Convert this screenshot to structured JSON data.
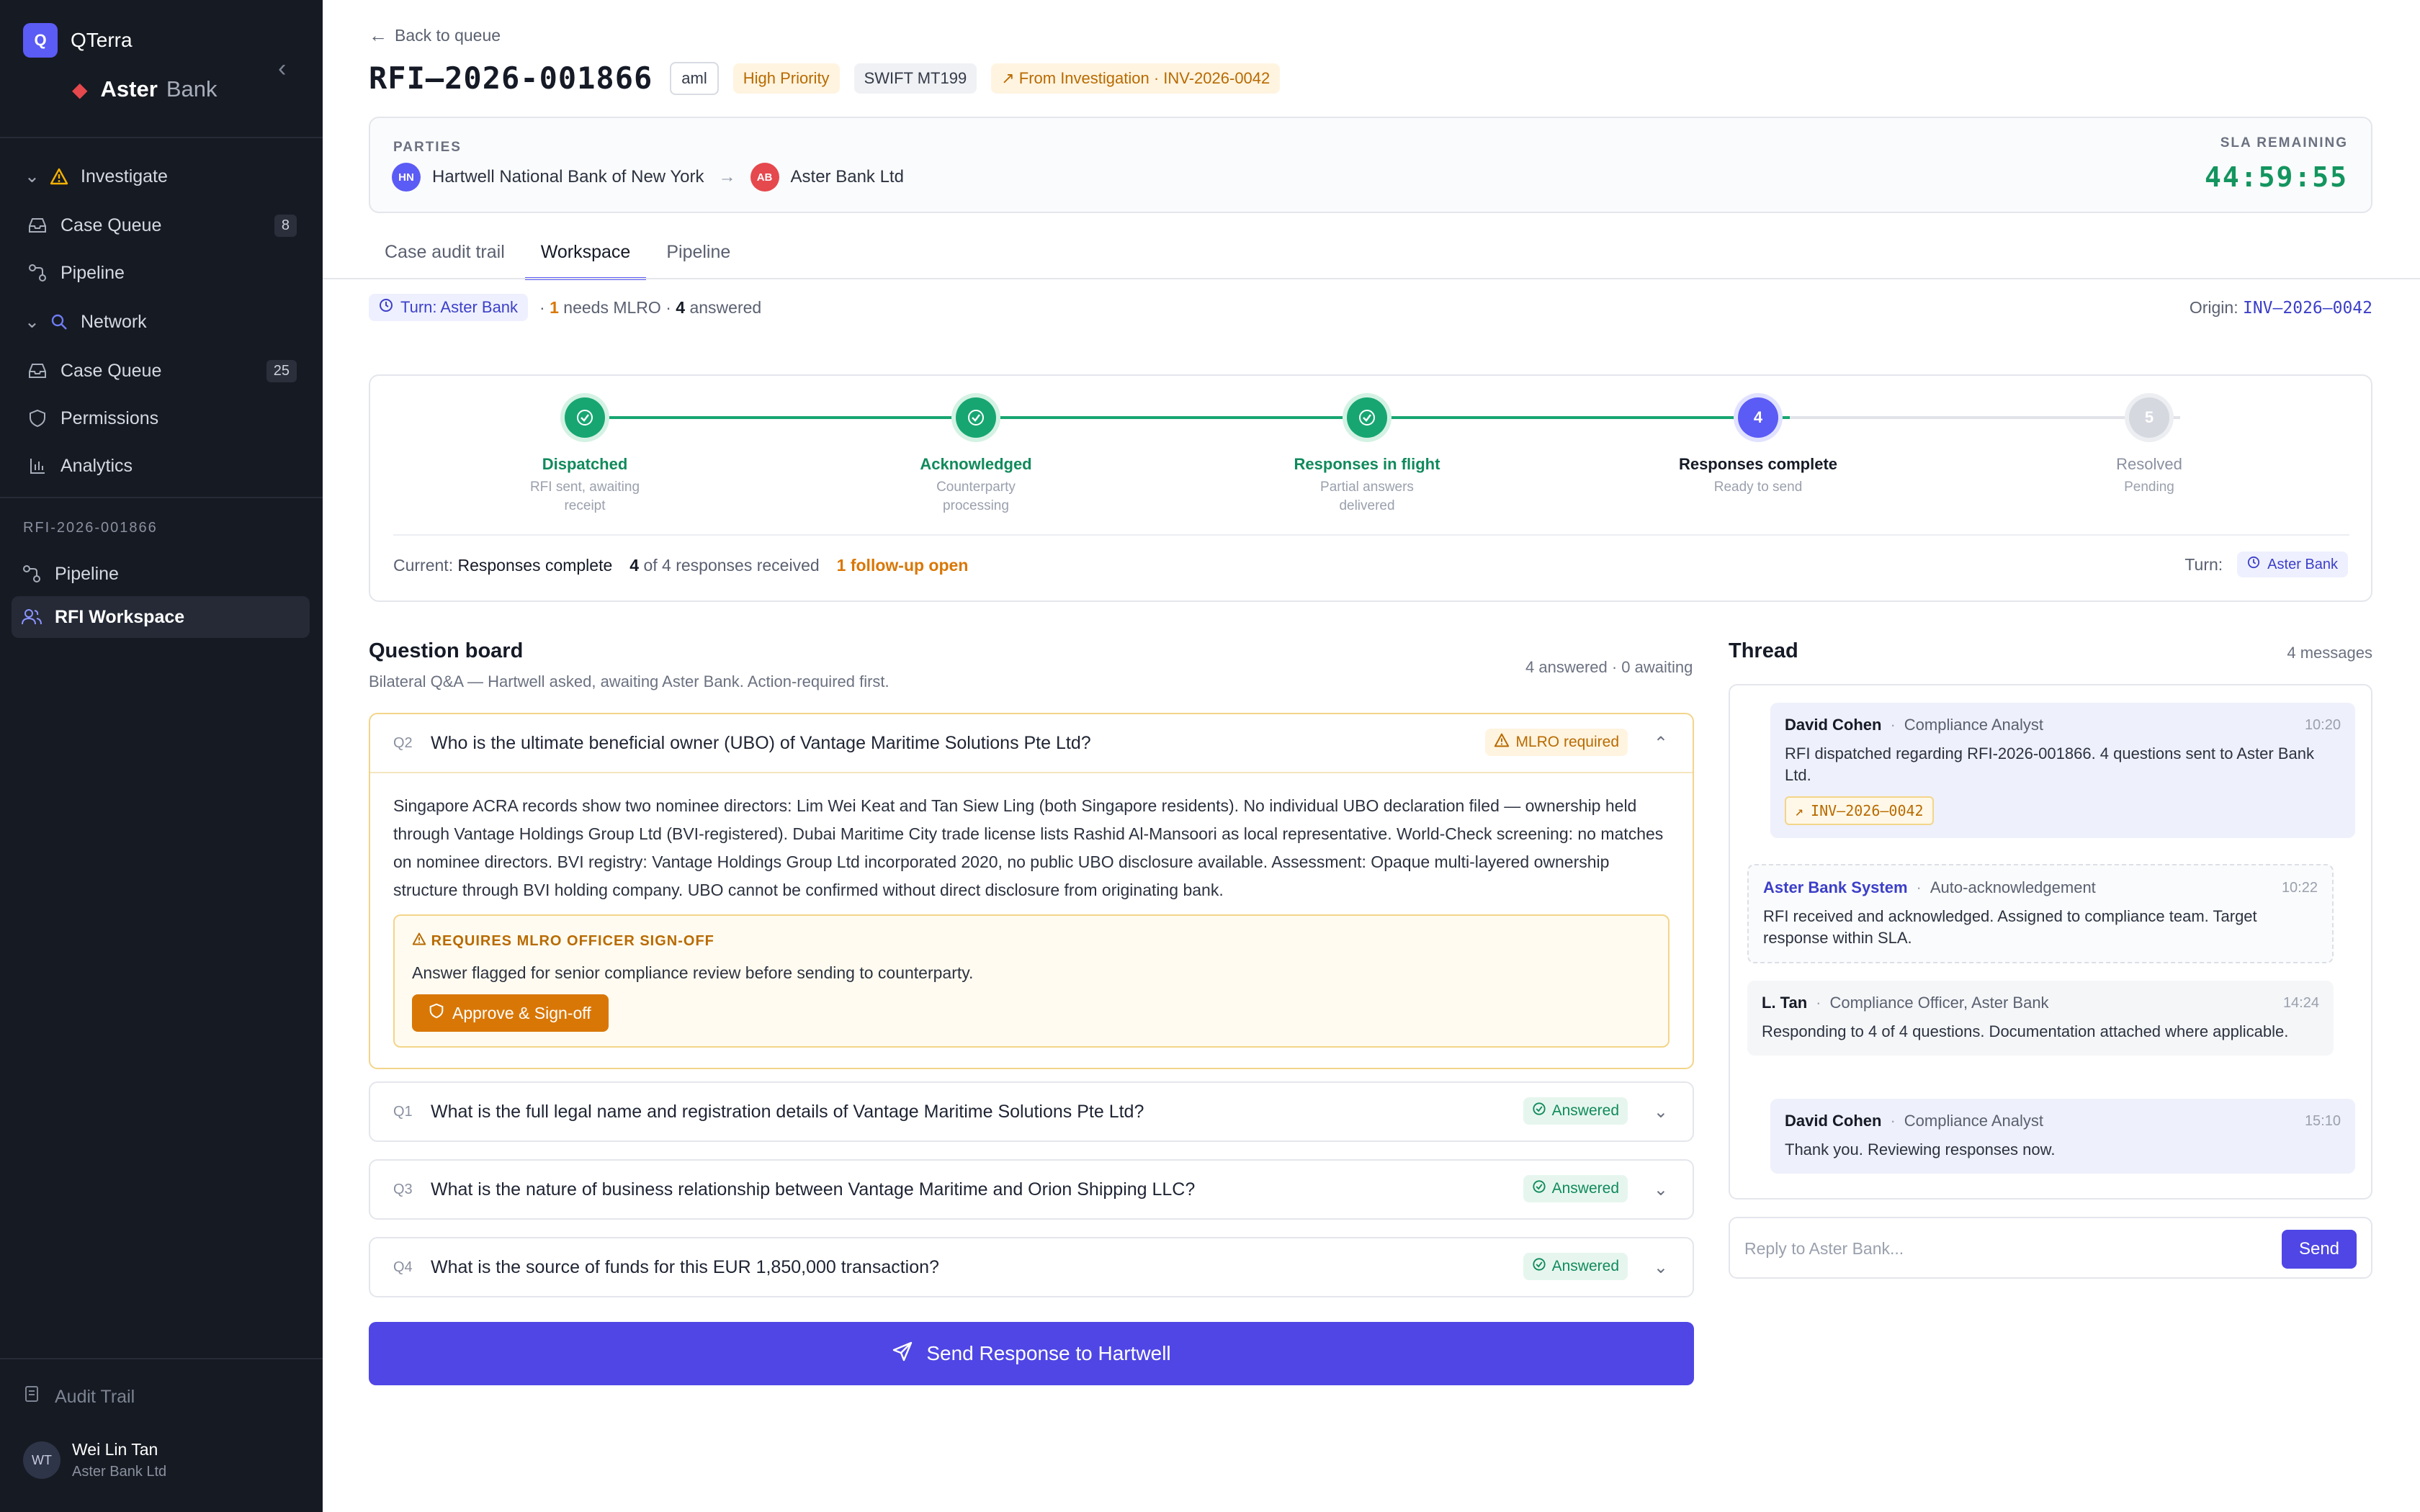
{
  "sidebar": {
    "app_name": "QTerra",
    "logo_letter": "Q",
    "bank_name_bold": "Aster",
    "bank_name_light": "Bank",
    "groups": {
      "investigate": {
        "label": "Investigate",
        "items": [
          {
            "label": "Case Queue",
            "count": "8"
          },
          {
            "label": "Pipeline"
          }
        ]
      },
      "network": {
        "label": "Network",
        "items": [
          {
            "label": "Case Queue",
            "count": "25"
          },
          {
            "label": "Permissions"
          },
          {
            "label": "Analytics"
          }
        ]
      }
    },
    "case_section": "RFI-2026-001866",
    "case_items": [
      {
        "label": "Pipeline"
      },
      {
        "label": "RFI Workspace"
      }
    ],
    "audit_trail": "Audit Trail",
    "user": {
      "initials": "WT",
      "name": "Wei Lin Tan",
      "org": "Aster Bank Ltd"
    }
  },
  "header": {
    "back": "Back to queue",
    "title": "RFI–2026-001866",
    "tags": {
      "aml": "aml",
      "priority": "High Priority",
      "swift": "SWIFT MT199",
      "investigation": "From Investigation · INV-2026-0042"
    }
  },
  "parties": {
    "label": "PARTIES",
    "from": {
      "initials": "HN",
      "name": "Hartwell National Bank of New York"
    },
    "to": {
      "initials": "AB",
      "name": "Aster Bank Ltd"
    },
    "sla_label": "SLA REMAINING",
    "sla_value": "44:59:55"
  },
  "tabs": [
    "Case audit trail",
    "Workspace",
    "Pipeline"
  ],
  "status": {
    "turn": "Turn: Aster Bank",
    "needs_count": "1",
    "needs_label": "needs MLRO",
    "answered_count": "4",
    "answered_label": "answered",
    "origin_label": "Origin:",
    "origin_value": "INV–2026–0042"
  },
  "progress": {
    "steps": [
      {
        "title": "Dispatched",
        "sub": "RFI sent, awaiting receipt",
        "state": "done"
      },
      {
        "title": "Acknowledged",
        "sub": "Counterparty processing",
        "state": "done"
      },
      {
        "title": "Responses in flight",
        "sub": "Partial answers delivered",
        "state": "done"
      },
      {
        "title": "Responses complete",
        "sub": "Ready to send",
        "state": "current",
        "num": "4"
      },
      {
        "title": "Resolved",
        "sub": "Pending",
        "state": "pending",
        "num": "5"
      }
    ],
    "current_label": "Current:",
    "current_value": "Responses complete",
    "received_count": "4",
    "received_label": "of 4 responses received",
    "followup": "1 follow-up open",
    "turn_label": "Turn:",
    "turn_value": "Aster Bank"
  },
  "question_board": {
    "title": "Question board",
    "subtitle": "Bilateral Q&A — Hartwell asked, awaiting Aster Bank. Action-required first.",
    "counts": "4 answered · 0 awaiting",
    "questions": [
      {
        "num": "Q2",
        "text": "Who is the ultimate beneficial owner (UBO) of Vantage Maritime Solutions Pte Ltd?",
        "badge": "MLRO required",
        "answer": "Singapore ACRA records show two nominee directors: Lim Wei Keat and Tan Siew Ling (both Singapore residents). No individual UBO declaration filed — ownership held through Vantage Holdings Group Ltd (BVI-registered). Dubai Maritime City trade license lists Rashid Al-Mansoori as local representative. World-Check screening: no matches on nominee directors. BVI registry: Vantage Holdings Group Ltd incorporated 2020, no public UBO disclosure available. Assessment: Opaque multi-layered ownership structure through BVI holding company. UBO cannot be confirmed without direct disclosure from originating bank.",
        "signoff_title": "REQUIRES MLRO OFFICER SIGN-OFF",
        "signoff_text": "Answer flagged for senior compliance review before sending to counterparty.",
        "signoff_button": "Approve & Sign-off"
      },
      {
        "num": "Q1",
        "text": "What is the full legal name and registration details of Vantage Maritime Solutions Pte Ltd?",
        "badge": "Answered"
      },
      {
        "num": "Q3",
        "text": "What is the nature of business relationship between Vantage Maritime and Orion Shipping LLC?",
        "badge": "Answered"
      },
      {
        "num": "Q4",
        "text": "What is the source of funds for this EUR 1,850,000 transaction?",
        "badge": "Answered"
      }
    ],
    "send_button": "Send Response to Hartwell"
  },
  "thread": {
    "title": "Thread",
    "count": "4 messages",
    "messages": [
      {
        "name": "David Cohen",
        "role": "Compliance Analyst",
        "time": "10:20",
        "body": "RFI dispatched regarding RFI-2026-001866. 4 questions sent to Aster Bank Ltd.",
        "chip": "INV–2026–0042"
      },
      {
        "name": "Aster Bank System",
        "role": "Auto-acknowledgement",
        "time": "10:22",
        "body": "RFI received and acknowledged. Assigned to compliance team. Target response within SLA."
      },
      {
        "name": "L. Tan",
        "role": "Compliance Officer, Aster Bank",
        "time": "14:24",
        "body": "Responding to 4 of 4 questions. Documentation attached where applicable."
      },
      {
        "name": "David Cohen",
        "role": "Compliance Analyst",
        "time": "15:10",
        "body": "Thank you. Reviewing responses now."
      }
    ],
    "reply_placeholder": "Reply to Aster Bank...",
    "send": "Send"
  },
  "colors": {
    "accent": "#4f46e5",
    "success": "#17a672",
    "warning": "#d97706",
    "sidebar": "#161a22"
  }
}
